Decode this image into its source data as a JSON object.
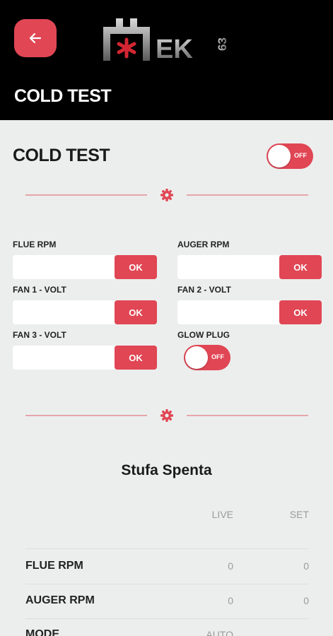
{
  "header": {
    "title": "COLD TEST",
    "back_icon": "arrow-left-icon",
    "logo_text": "EK",
    "logo_sub": "63"
  },
  "cold_test": {
    "title": "COLD TEST",
    "toggle_label": "OFF"
  },
  "fields": [
    {
      "label": "FLUE RPM",
      "value": "",
      "button": "OK"
    },
    {
      "label": "AUGER RPM",
      "value": "",
      "button": "OK"
    },
    {
      "label": "FAN 1 - VOLT",
      "value": "",
      "button": "OK"
    },
    {
      "label": "FAN 2 - VOLT",
      "value": "",
      "button": "OK"
    },
    {
      "label": "FAN 3 - VOLT",
      "value": "",
      "button": "OK"
    }
  ],
  "glow_plug": {
    "label": "GLOW PLUG",
    "toggle_label": "OFF"
  },
  "status": {
    "title": "Stufa Spenta",
    "columns": [
      "LIVE",
      "SET"
    ],
    "rows": [
      {
        "label": "FLUE RPM",
        "live": "0",
        "set": "0"
      },
      {
        "label": "AUGER RPM",
        "live": "0",
        "set": "0"
      },
      {
        "label": "MODE",
        "live": "AUTO",
        "set": ""
      }
    ]
  },
  "colors": {
    "accent": "#e04654",
    "header_bg": "#000000",
    "page_bg": "#eceeed"
  }
}
